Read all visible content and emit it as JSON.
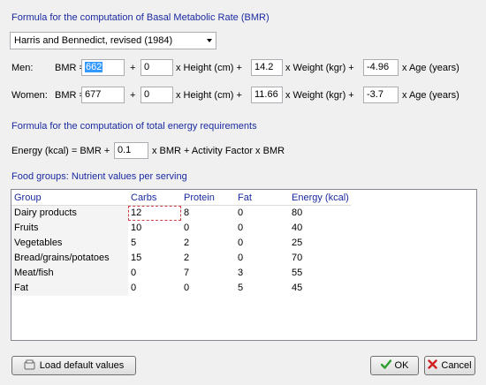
{
  "bmr": {
    "title": "Formula for the computation of Basal Metabolic Rate (BMR)",
    "formula_select": "Harris and Bennedict, revised (1984)",
    "men": {
      "label": "Men:",
      "bmr_label": "BMR =",
      "constant": "662",
      "plus1": "+",
      "height_coef": "0",
      "height_label": "x Height (cm) +",
      "weight_coef": "14.2",
      "weight_label": "x Weight (kgr) +",
      "age_coef": "-4.96",
      "age_label": "x Age (years)"
    },
    "women": {
      "label": "Women:",
      "bmr_label": "BMR =",
      "constant": "677",
      "plus1": "+",
      "height_coef": "0",
      "height_label": "x Height (cm) +",
      "weight_coef": "11.66",
      "weight_label": "x Weight (kgr) +",
      "age_coef": "-3.7",
      "age_label": "x Age (years)"
    }
  },
  "energy": {
    "title": "Formula for the computation of total energy requirements",
    "prefix": "Energy (kcal) = BMR +",
    "coef": "0.1",
    "suffix": "x BMR + Activity Factor x BMR"
  },
  "food": {
    "title": "Food groups: Nutrient values per serving",
    "headers": [
      "Group",
      "Carbs",
      "Protein",
      "Fat",
      "Energy (kcal)"
    ],
    "rows": [
      [
        "Dairy products",
        "12",
        "8",
        "0",
        "80"
      ],
      [
        "Fruits",
        "10",
        "0",
        "0",
        "40"
      ],
      [
        "Vegetables",
        "5",
        "2",
        "0",
        "25"
      ],
      [
        "Bread/grains/potatoes",
        "15",
        "2",
        "0",
        "70"
      ],
      [
        "Meat/fish",
        "0",
        "7",
        "3",
        "55"
      ],
      [
        "Fat",
        "0",
        "0",
        "5",
        "45"
      ]
    ]
  },
  "buttons": {
    "load_defaults": "Load default values",
    "ok": "OK",
    "cancel": "Cancel"
  },
  "colors": {
    "section_title": "#1a2aa0",
    "ok_check": "#2e9e2e",
    "cancel_x": "#d02020"
  }
}
